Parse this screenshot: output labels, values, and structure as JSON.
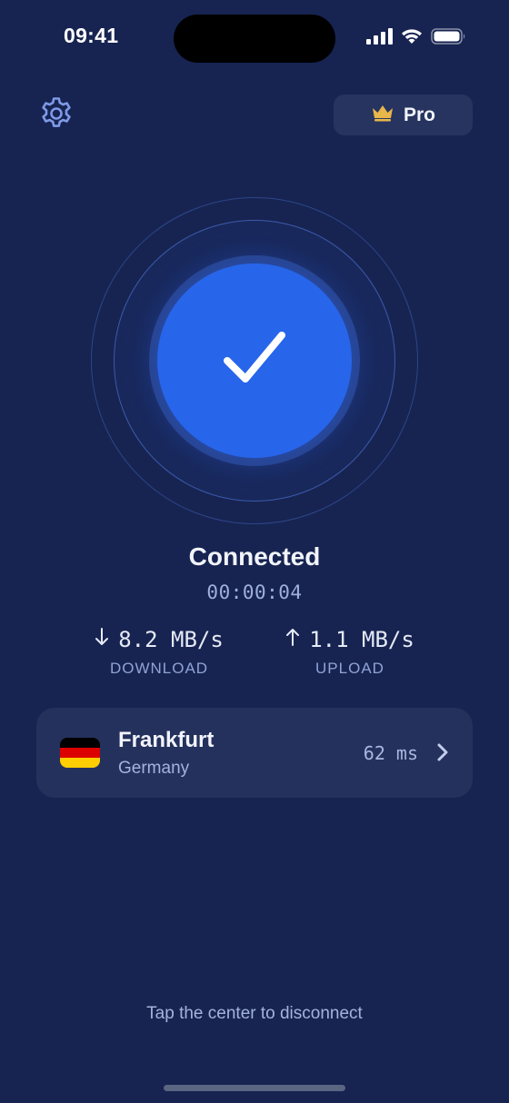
{
  "status_bar": {
    "time": "09:41"
  },
  "header": {
    "pro_label": "Pro"
  },
  "connection": {
    "state": "Connected",
    "timer": "00:00:04",
    "download": {
      "value": "8.2 MB/s",
      "label": "DOWNLOAD"
    },
    "upload": {
      "value": "1.1 MB/s",
      "label": "UPLOAD"
    }
  },
  "server": {
    "city": "Frankfurt",
    "country": "Germany",
    "ping": "62 ms"
  },
  "footer": {
    "hint": "Tap the center to disconnect"
  },
  "colors": {
    "background": "#172451",
    "accent": "#2765ea",
    "card": "#24315d",
    "crown": "#e8b64a"
  }
}
